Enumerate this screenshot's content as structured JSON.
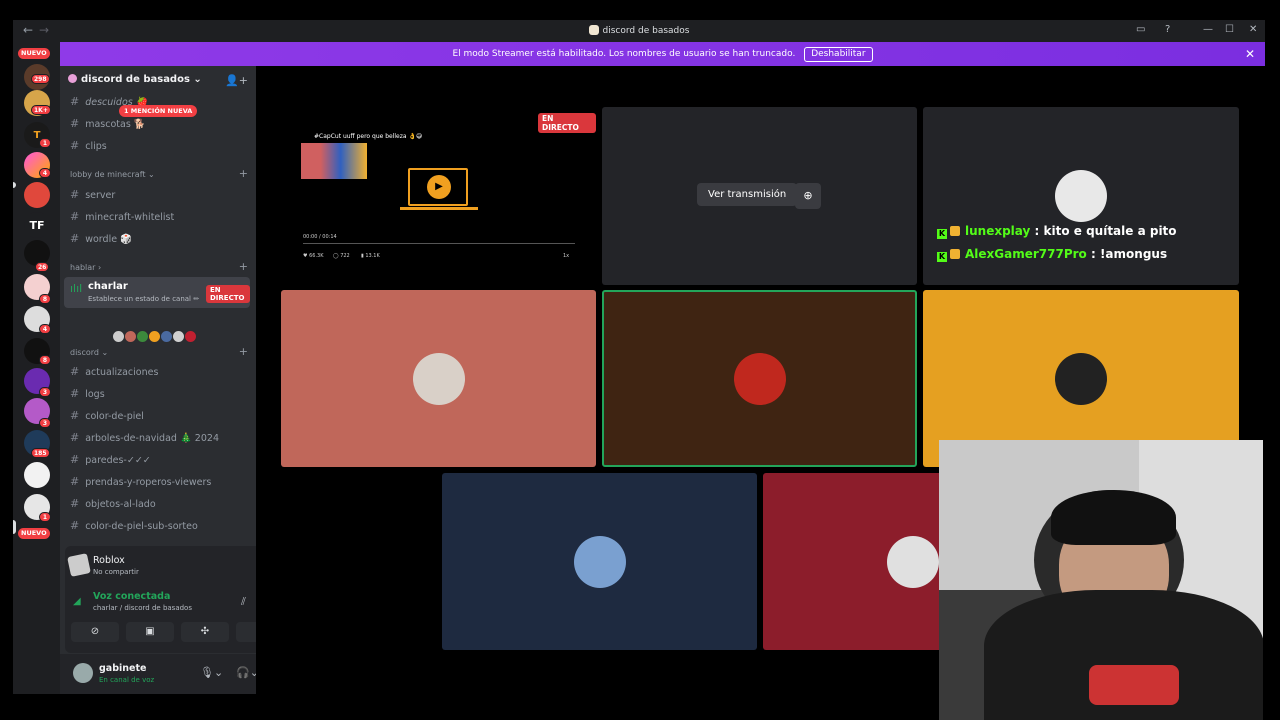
{
  "window": {
    "title": "discord de basados",
    "back_icon": "←",
    "forward_icon": "→",
    "controls": [
      "▭",
      "?",
      "—",
      "☐",
      "✕"
    ]
  },
  "banner": {
    "text": "El modo Streamer está habilitado. Los nombres de usuario se han truncado.",
    "button": "Deshabilitar",
    "close": "✕"
  },
  "rail": {
    "new_top": "NUEVO",
    "new_bottom": "NUEVO",
    "badges": [
      "298",
      "1K+",
      "1",
      "4",
      "26",
      "8",
      "4",
      "8",
      "3",
      "3",
      "185",
      "1"
    ],
    "tf_label": "TF"
  },
  "sidebar": {
    "server_name": "discord de basados",
    "server_chevron": "⌄",
    "mention_pill": "1 MENCIÓN NUEVA",
    "channels_top": [
      {
        "name": "descuidos 🍓"
      },
      {
        "name": "mascotas 🐕"
      },
      {
        "name": "clips"
      }
    ],
    "category_minecraft": "lobby de minecraft",
    "channels_minecraft": [
      {
        "name": "server"
      },
      {
        "name": "minecraft-whitelist"
      },
      {
        "name": "wordle 🎲"
      }
    ],
    "category_hablar": "hablar",
    "voice_channel": {
      "name": "charlar",
      "status": "Establece un estado de canal ✏",
      "live": "EN DIRECTO"
    },
    "category_discord": "discord",
    "channels_discord": [
      {
        "name": "actualizaciones"
      },
      {
        "name": "logs"
      },
      {
        "name": "color-de-piel"
      },
      {
        "name": "arboles-de-navidad 🎄 2024"
      },
      {
        "name": "paredes-✓✓✓"
      },
      {
        "name": "prendas-y-roperos-viewers"
      },
      {
        "name": "objetos-al-lado"
      },
      {
        "name": "color-de-piel-sub-sorteo"
      }
    ],
    "activity": {
      "title": "Roblox",
      "subtitle": "No compartir"
    },
    "voice": {
      "title": "Voz conectada",
      "subtitle": "charlar / discord de basados"
    },
    "user": {
      "name": "gabinete",
      "status": "En canal de voz"
    }
  },
  "main": {
    "stream_live": "EN DIRECTO",
    "stream_caption": "#CapCut uuff pero que belleza 👌😅",
    "stream_time": "00:00 / 00:14",
    "stream_stats": [
      "66.3K",
      "722",
      "13.1K"
    ],
    "stream_speed": "1x",
    "watch_button": "Ver transmisión",
    "chat": [
      {
        "user": "lunexplay",
        "message": " : kito e quítale a pito"
      },
      {
        "user": "AlexGamer777Pro",
        "message": " : !amongus"
      }
    ],
    "colors": {
      "tile1": "#c0675a",
      "tile2": "#3f2412",
      "tile3": "#e5a021",
      "tile4": "#1e2a40",
      "tile5": "#8c1d2b"
    }
  }
}
